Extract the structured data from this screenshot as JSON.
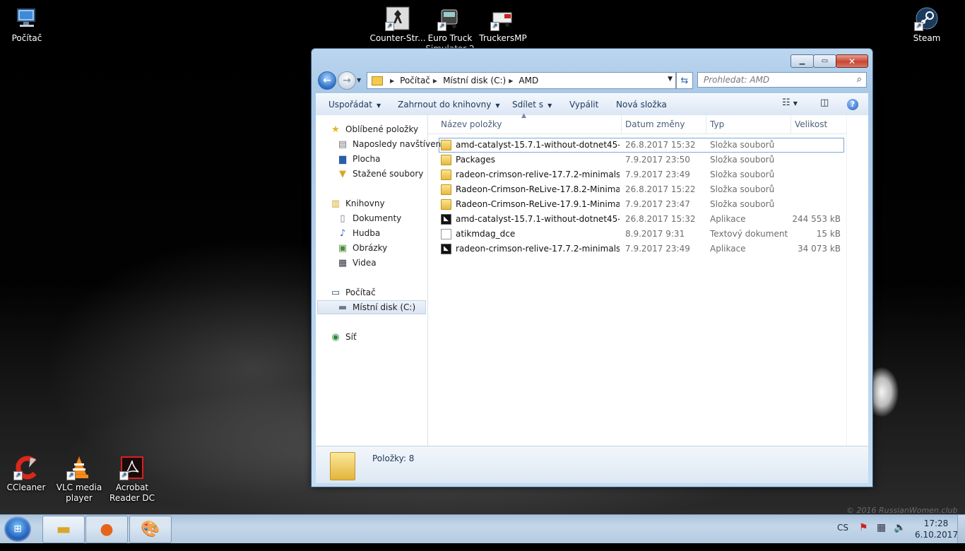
{
  "desktop": {
    "icons": [
      {
        "label": "Počítač",
        "icon": "computer-icon"
      },
      {
        "label": "Counter-Str...",
        "icon": "counter-strike-icon"
      },
      {
        "label": "Euro Truck Simulator 2",
        "icon": "euro-truck-icon"
      },
      {
        "label": "TruckersMP",
        "icon": "truckersmp-icon"
      },
      {
        "label": "Steam",
        "icon": "steam-icon"
      },
      {
        "label": "CCleaner",
        "icon": "ccleaner-icon"
      },
      {
        "label": "VLC media player",
        "icon": "vlc-icon"
      },
      {
        "label": "Acrobat Reader DC",
        "icon": "acrobat-icon"
      }
    ],
    "watermark": "© 2016 RussianWomen.club"
  },
  "explorer": {
    "breadcrumb": [
      "Počítač",
      "Místní disk (C:)",
      "AMD"
    ],
    "search_placeholder": "Prohledat: AMD",
    "toolbar": {
      "organize": "Uspořádat",
      "include": "Zahrnout do knihovny",
      "share": "Sdílet s",
      "burn": "Vypálit",
      "new_folder": "Nová složka"
    },
    "navpane": {
      "favorites": "Oblíbené položky",
      "recent": "Naposledy navštívené",
      "desktop": "Plocha",
      "downloads": "Stažené soubory",
      "libraries": "Knihovny",
      "documents": "Dokumenty",
      "music": "Hudba",
      "pictures": "Obrázky",
      "videos": "Videa",
      "computer": "Počítač",
      "local_disk": "Místní disk (C:)",
      "network": "Síť"
    },
    "columns": {
      "name": "Název položky",
      "date": "Datum změny",
      "type": "Typ",
      "size": "Velikost"
    },
    "files": [
      {
        "name": "amd-catalyst-15.7.1-without-dotnet45-w...",
        "date": "26.8.2017 15:32",
        "type": "Složka souborů",
        "size": "",
        "kind": "folder"
      },
      {
        "name": "Packages",
        "date": "7.9.2017 23:50",
        "type": "Složka souborů",
        "size": "",
        "kind": "folder"
      },
      {
        "name": "radeon-crimson-relive-17.7.2-minimalset...",
        "date": "7.9.2017 23:49",
        "type": "Složka souborů",
        "size": "",
        "kind": "folder"
      },
      {
        "name": "Radeon-Crimson-ReLive-17.8.2-Minimal...",
        "date": "26.8.2017 15:22",
        "type": "Složka souborů",
        "size": "",
        "kind": "folder"
      },
      {
        "name": "Radeon-Crimson-ReLive-17.9.1-Minimal...",
        "date": "7.9.2017 23:47",
        "type": "Složka souborů",
        "size": "",
        "kind": "folder"
      },
      {
        "name": "amd-catalyst-15.7.1-without-dotnet45-w...",
        "date": "26.8.2017 15:32",
        "type": "Aplikace",
        "size": "244 553 kB",
        "kind": "app"
      },
      {
        "name": "atikmdag_dce",
        "date": "8.9.2017 9:31",
        "type": "Textový dokument",
        "size": "15 kB",
        "kind": "doc"
      },
      {
        "name": "radeon-crimson-relive-17.7.2-minimalset...",
        "date": "7.9.2017 23:49",
        "type": "Aplikace",
        "size": "34 073 kB",
        "kind": "app"
      }
    ],
    "status": "Položky: 8"
  },
  "taskbar": {
    "language": "CS",
    "time": "17:28",
    "date": "6.10.2017"
  }
}
